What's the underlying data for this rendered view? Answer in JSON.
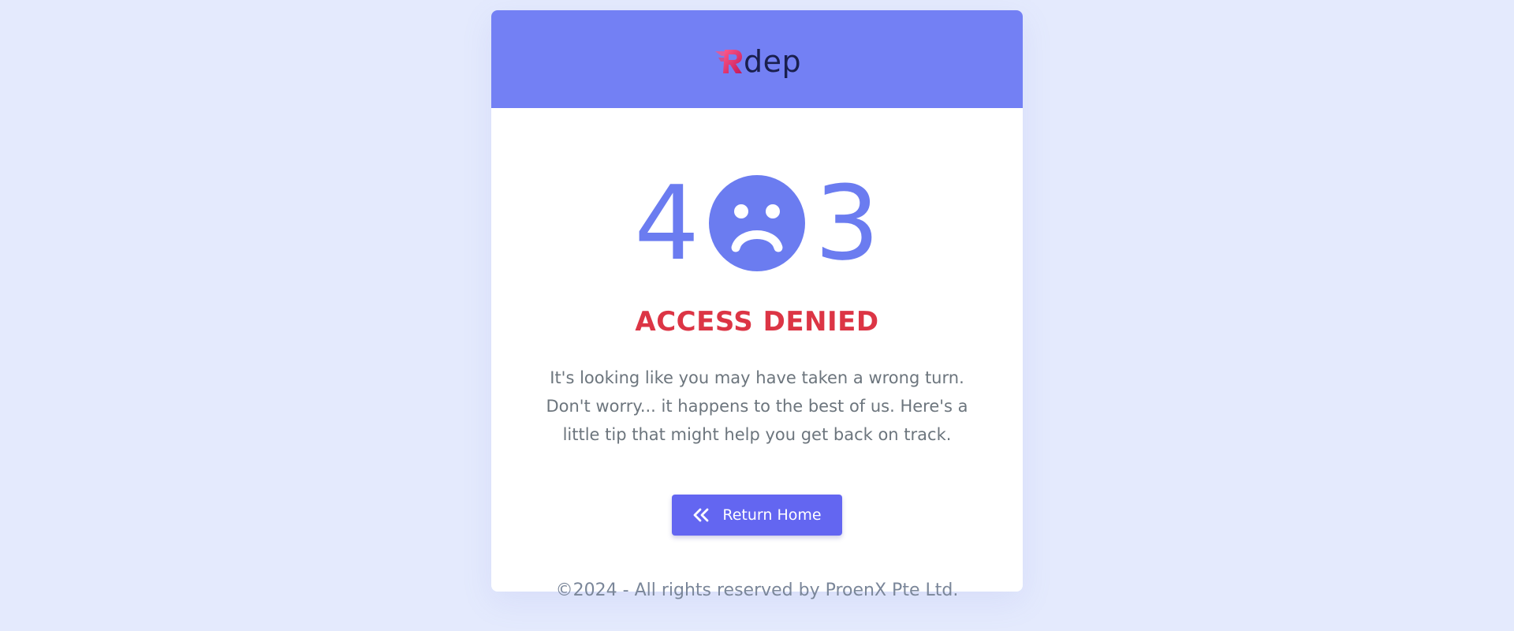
{
  "header": {
    "logo_text": "dep",
    "logo_mark_letter": "R"
  },
  "error": {
    "digit_left": "4",
    "digit_right": "3",
    "face_icon": "sad-face-icon",
    "headline": "ACCESS DENIED",
    "message": "It's looking like you may have taken a wrong turn. Don't worry... it happens to the best of us. Here's a little tip that might help you get back on track."
  },
  "actions": {
    "return_home_label": "Return Home",
    "return_home_icon": "double-chevron-left-icon"
  },
  "footer": {
    "text": "©2024 - All rights reserved by ProenX Pte Ltd."
  },
  "colors": {
    "page_background": "#e4eafd",
    "header_background": "#7380f4",
    "accent": "#6b7cf0",
    "button": "#6366f1",
    "danger": "#dc3545",
    "body_text": "#6c757d"
  }
}
